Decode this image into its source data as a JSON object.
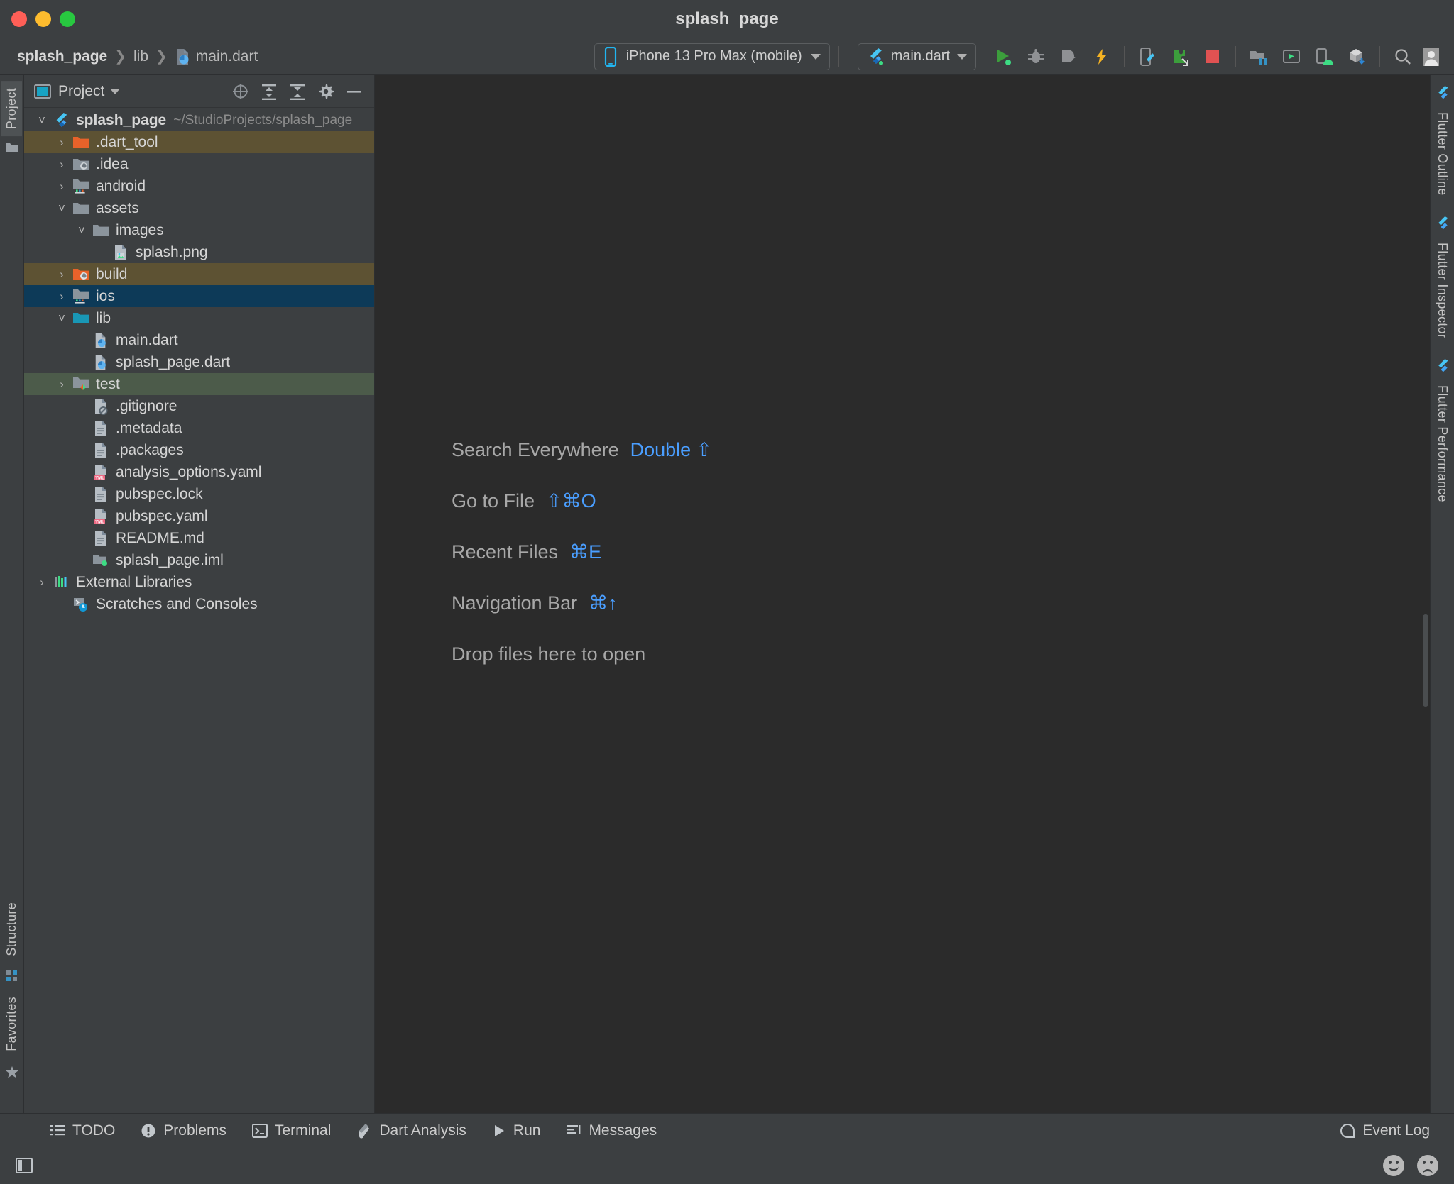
{
  "window": {
    "title": "splash_page",
    "traffic_lights": [
      "close-button",
      "minimize-button",
      "maximize-button"
    ]
  },
  "navbar": {
    "breadcrumbs": [
      {
        "label": "splash_page",
        "icon": ""
      },
      {
        "label": "lib",
        "icon": ""
      },
      {
        "label": "main.dart",
        "icon": "dart-file-icon"
      }
    ],
    "device_selector": {
      "label": "iPhone 13 Pro Max (mobile)",
      "icon": "phone-icon",
      "dropdown": "chevron-down-icon"
    },
    "run_config": {
      "label": "main.dart",
      "icon": "flutter-icon",
      "dropdown": "chevron-down-icon"
    },
    "actions": [
      {
        "name": "run-button",
        "icon": "play-icon",
        "color": "#3c9e3c"
      },
      {
        "name": "debug-button",
        "icon": "bug-icon",
        "color": "#8f9194"
      },
      {
        "name": "run-with-coverage-button",
        "icon": "coverage-icon",
        "color": "#8f9194"
      },
      {
        "name": "hot-reload-button",
        "icon": "lightning-icon",
        "color": "#f5b323"
      },
      {
        "name": "open-devtools-button",
        "icon": "device-flutter-icon",
        "color": "#8f9194"
      },
      {
        "name": "flutter-inspector-button",
        "icon": "puzzle-icon",
        "color": "#3c9e3c"
      },
      {
        "name": "stop-button",
        "icon": "stop-square-icon",
        "color": "#e05252"
      },
      {
        "name": "project-structure-button",
        "icon": "project-structure-icon",
        "color": "#8f9194"
      },
      {
        "name": "avd-manager-button",
        "icon": "avd-manager-icon",
        "color": "#8f9194"
      },
      {
        "name": "device-manager-button",
        "icon": "device-manager-icon",
        "color": "#8f9194"
      },
      {
        "name": "sdk-manager-button",
        "icon": "sdk-manager-icon",
        "color": "#8f9194"
      },
      {
        "name": "search-button",
        "icon": "search-icon",
        "color": "#b4b4b4"
      },
      {
        "name": "account-button",
        "icon": "user-avatar-icon",
        "color": "#b4b4b4"
      }
    ]
  },
  "left_rail": {
    "tabs": [
      {
        "label": "Project",
        "selected": true
      },
      {
        "label": "Structure",
        "selected": false
      },
      {
        "label": "Favorites",
        "selected": false
      }
    ]
  },
  "right_rail": {
    "tabs": [
      {
        "label": "Flutter Outline"
      },
      {
        "label": "Flutter Inspector"
      },
      {
        "label": "Flutter Performance"
      }
    ]
  },
  "project_panel": {
    "header": {
      "title": "Project",
      "view_icon": "project-view-icon",
      "dropdown_icon": "chevron-down-icon",
      "actions": [
        {
          "name": "select-opened-file-button",
          "icon": "crosshair-icon"
        },
        {
          "name": "expand-all-button",
          "icon": "expand-all-icon"
        },
        {
          "name": "collapse-all-button",
          "icon": "collapse-all-icon"
        },
        {
          "name": "settings-button",
          "icon": "gear-icon"
        },
        {
          "name": "hide-button",
          "icon": "minus-icon"
        }
      ]
    },
    "tree": [
      {
        "label": "splash_page",
        "sub": "~/StudioProjects/splash_page",
        "indent": 0,
        "arrow": "down",
        "icon": "flutter-icon",
        "bold": true,
        "highlight": "none"
      },
      {
        "label": ".dart_tool",
        "sub": "",
        "indent": 1,
        "arrow": "right",
        "icon": "folder-orange-icon",
        "bold": false,
        "highlight": "excluded"
      },
      {
        "label": ".idea",
        "sub": "",
        "indent": 1,
        "arrow": "right",
        "icon": "folder-idea-icon",
        "bold": false,
        "highlight": "none"
      },
      {
        "label": "android",
        "sub": "",
        "indent": 1,
        "arrow": "right",
        "icon": "folder-android-icon",
        "bold": false,
        "highlight": "none"
      },
      {
        "label": "assets",
        "sub": "",
        "indent": 1,
        "arrow": "down",
        "icon": "folder-icon",
        "bold": false,
        "highlight": "none"
      },
      {
        "label": "images",
        "sub": "",
        "indent": 2,
        "arrow": "down",
        "icon": "folder-icon",
        "bold": false,
        "highlight": "none"
      },
      {
        "label": "splash.png",
        "sub": "",
        "indent": 3,
        "arrow": "none",
        "icon": "image-file-icon",
        "bold": false,
        "highlight": "none"
      },
      {
        "label": "build",
        "sub": "",
        "indent": 1,
        "arrow": "right",
        "icon": "folder-orange-idea-icon",
        "bold": false,
        "highlight": "excluded"
      },
      {
        "label": "ios",
        "sub": "",
        "indent": 1,
        "arrow": "right",
        "icon": "folder-android-icon",
        "bold": false,
        "highlight": "selected"
      },
      {
        "label": "lib",
        "sub": "",
        "indent": 1,
        "arrow": "down",
        "icon": "folder-source-icon",
        "bold": false,
        "highlight": "none"
      },
      {
        "label": "main.dart",
        "sub": "",
        "indent": 2,
        "arrow": "none",
        "icon": "dart-file-icon",
        "bold": false,
        "highlight": "none"
      },
      {
        "label": "splash_page.dart",
        "sub": "",
        "indent": 2,
        "arrow": "none",
        "icon": "dart-file-icon",
        "bold": false,
        "highlight": "none"
      },
      {
        "label": "test",
        "sub": "",
        "indent": 1,
        "arrow": "right",
        "icon": "folder-test-icon",
        "bold": false,
        "highlight": "test"
      },
      {
        "label": ".gitignore",
        "sub": "",
        "indent": 2,
        "arrow": "none",
        "icon": "gitignore-file-icon",
        "bold": false,
        "highlight": "none"
      },
      {
        "label": ".metadata",
        "sub": "",
        "indent": 2,
        "arrow": "none",
        "icon": "text-file-icon",
        "bold": false,
        "highlight": "none"
      },
      {
        "label": ".packages",
        "sub": "",
        "indent": 2,
        "arrow": "none",
        "icon": "text-file-icon",
        "bold": false,
        "highlight": "none"
      },
      {
        "label": "analysis_options.yaml",
        "sub": "",
        "indent": 2,
        "arrow": "none",
        "icon": "yaml-file-icon",
        "bold": false,
        "highlight": "none"
      },
      {
        "label": "pubspec.lock",
        "sub": "",
        "indent": 2,
        "arrow": "none",
        "icon": "text-file-icon",
        "bold": false,
        "highlight": "none"
      },
      {
        "label": "pubspec.yaml",
        "sub": "",
        "indent": 2,
        "arrow": "none",
        "icon": "yaml-file-icon",
        "bold": false,
        "highlight": "none"
      },
      {
        "label": "README.md",
        "sub": "",
        "indent": 2,
        "arrow": "none",
        "icon": "text-file-icon",
        "bold": false,
        "highlight": "none"
      },
      {
        "label": "splash_page.iml",
        "sub": "",
        "indent": 2,
        "arrow": "none",
        "icon": "iml-file-icon",
        "bold": false,
        "highlight": "none"
      },
      {
        "label": "External Libraries",
        "sub": "",
        "indent": 0,
        "arrow": "right",
        "icon": "libraries-icon",
        "bold": false,
        "highlight": "none"
      },
      {
        "label": "Scratches and Consoles",
        "sub": "",
        "indent": 0,
        "arrow": "none",
        "icon": "scratches-icon",
        "bold": false,
        "highlight": "none"
      }
    ]
  },
  "editor": {
    "hints": [
      {
        "label": "Search Everywhere",
        "keys": "Double ⇧"
      },
      {
        "label": "Go to File",
        "keys": "⇧⌘O"
      },
      {
        "label": "Recent Files",
        "keys": "⌘E"
      },
      {
        "label": "Navigation Bar",
        "keys": "⌘↑"
      },
      {
        "label": "Drop files here to open",
        "keys": ""
      }
    ]
  },
  "bottom_bar": {
    "items": [
      {
        "label": "TODO",
        "icon": "todo-list-icon"
      },
      {
        "label": "Problems",
        "icon": "problems-icon"
      },
      {
        "label": "Terminal",
        "icon": "terminal-icon"
      },
      {
        "label": "Dart Analysis",
        "icon": "dart-analysis-icon"
      },
      {
        "label": "Run",
        "icon": "run-play-icon"
      },
      {
        "label": "Messages",
        "icon": "messages-icon"
      }
    ],
    "event_log": {
      "label": "Event Log",
      "icon": "event-log-icon"
    }
  },
  "status_bar": {
    "layout_icon": "toggle-toolwindows-icon",
    "feedback": [
      {
        "name": "happy-face-button",
        "icon": "smiley-happy-icon"
      },
      {
        "name": "sad-face-button",
        "icon": "smiley-sad-icon"
      }
    ]
  },
  "colors": {
    "accent_blue": "#4a9eff",
    "selection_blue": "#0d3a58",
    "excluded_brown": "#5d5233",
    "test_green": "#4c5b4a",
    "panel_bg": "#3c3f41",
    "editor_bg": "#2b2b2b"
  }
}
